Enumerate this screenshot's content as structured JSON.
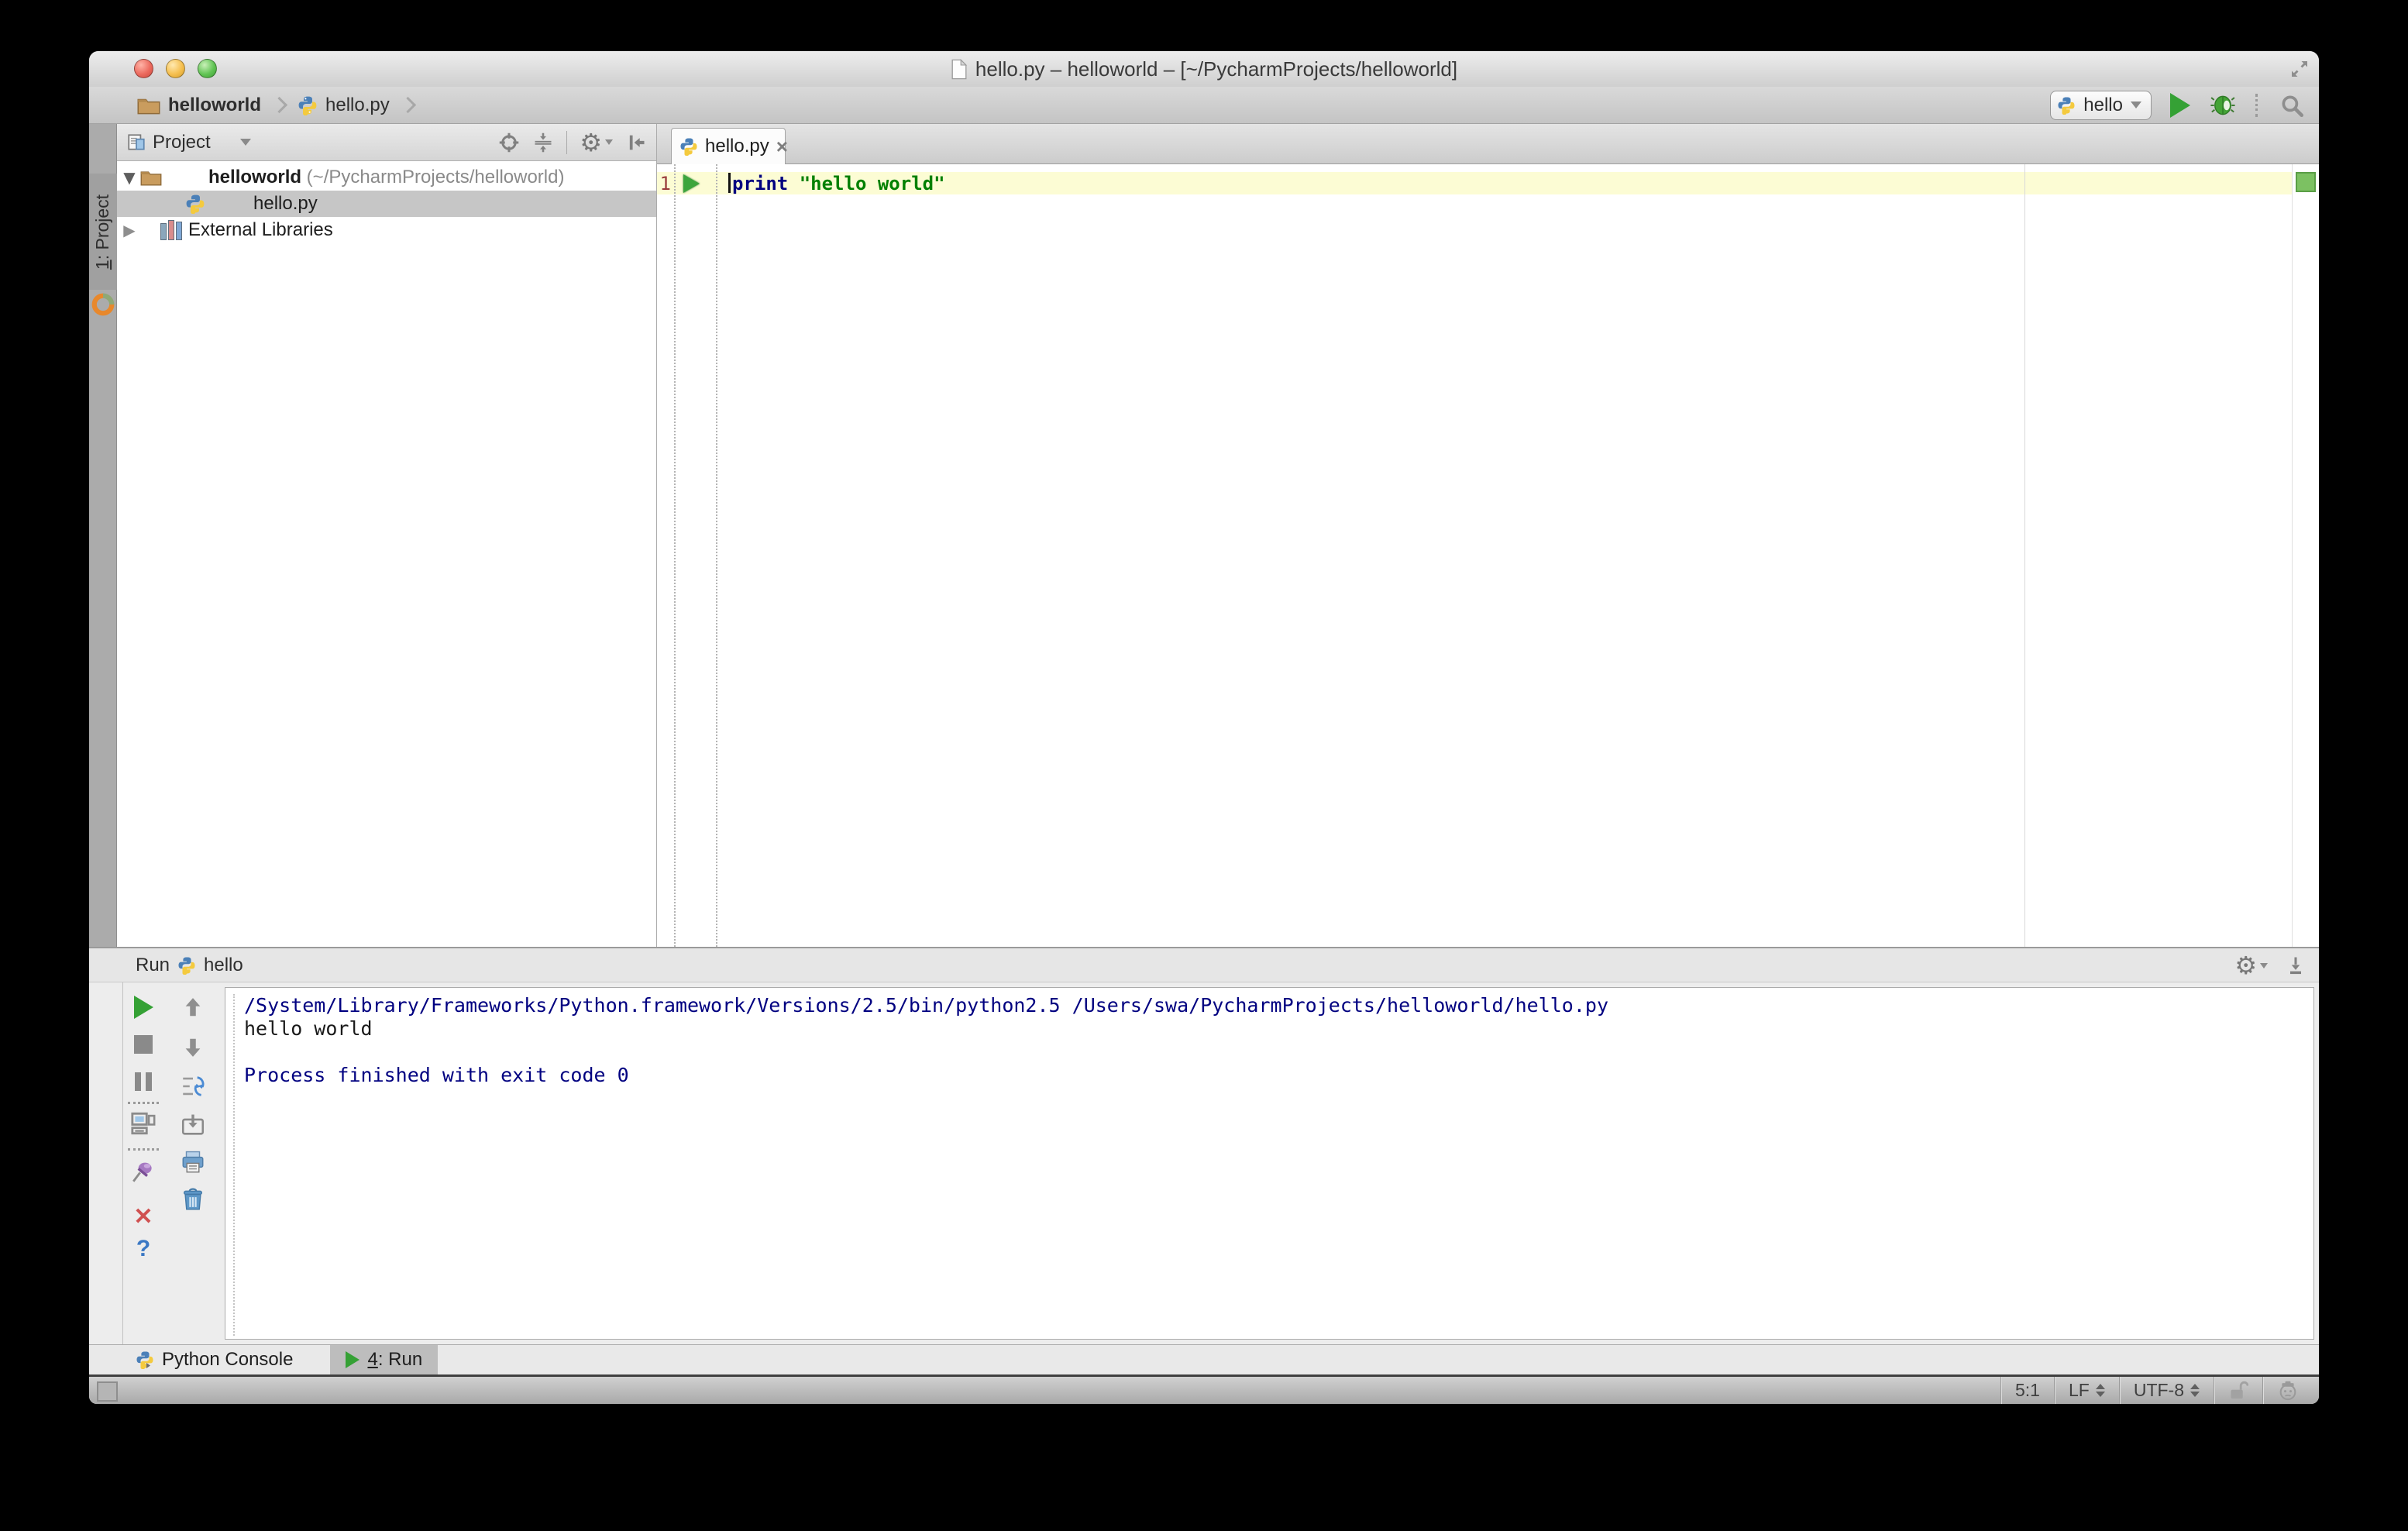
{
  "window": {
    "title": "hello.py – helloworld – [~/PycharmProjects/helloworld]"
  },
  "navbar": {
    "breadcrumb_project": "helloworld",
    "breadcrumb_file": "hello.py",
    "run_config": "hello"
  },
  "sidebar": {
    "tab_prefix": "1",
    "tab_rest": ": Project"
  },
  "project": {
    "header": "Project",
    "root_name": "helloworld",
    "root_path": " (~/PycharmProjects/helloworld)",
    "file": "hello.py",
    "libraries": "External Libraries",
    "expanded_glyph": "▼",
    "collapsed_glyph": "▶"
  },
  "editor": {
    "tab": "hello.py",
    "close_glyph": "×",
    "line_number": "1",
    "keyword": "print ",
    "string": "\"hello world\""
  },
  "run": {
    "label": "Run",
    "config": "hello",
    "close_glyph": "✕",
    "help_glyph": "?",
    "gear_glyph": "⚙",
    "console": [
      "/System/Library/Frameworks/Python.framework/Versions/2.5/bin/python2.5 /Users/swa/PycharmProjects/helloworld/hello.py",
      "hello world",
      "",
      "Process finished with exit code 0"
    ]
  },
  "bottom": {
    "console_tab": "Python Console",
    "run_tab_prefix": "4",
    "run_tab_rest": ": Run"
  },
  "status": {
    "position": "5:1",
    "line_ending": "LF",
    "encoding": "UTF-8"
  },
  "colors": {
    "keyword": "#000080",
    "string": "#008000",
    "console_system": "#000080",
    "line_highlight": "#FCFCD4",
    "run_green": "#35A135",
    "selection": "#C6C6C6",
    "inspection_ok": "#7CC162"
  }
}
